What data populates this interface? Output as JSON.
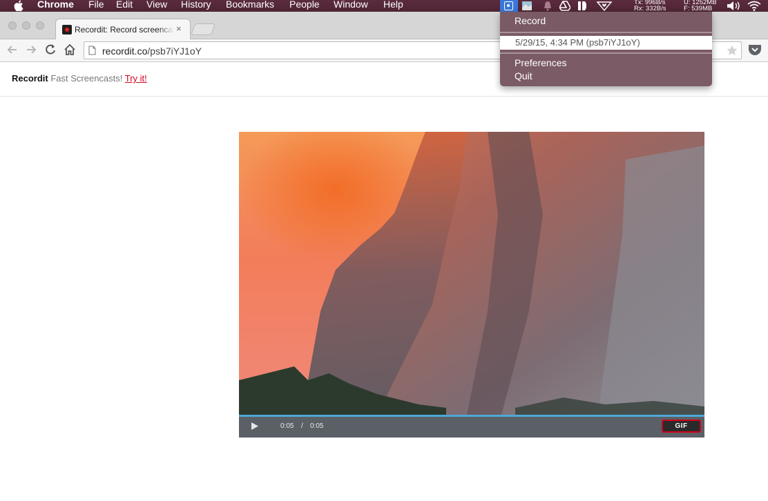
{
  "menubar": {
    "app_name": "Chrome",
    "items": [
      "File",
      "Edit",
      "View",
      "History",
      "Bookmarks",
      "People",
      "Window",
      "Help"
    ],
    "netstat": {
      "tx": "Tx:",
      "tx_rate": "996B/s",
      "rx": "Rx:",
      "rx_rate": "332B/s",
      "u": "U:",
      "u_mem": "1252MB",
      "f": "F:",
      "f_mem": "539MB"
    }
  },
  "browser": {
    "tab_title": "Recordit: Record screencasts",
    "tab_close": "×",
    "url_host": "recordit.co",
    "url_path": "/psb7iYJ1oY"
  },
  "site": {
    "brand": "Recordit",
    "tagline": " Fast Screencasts! ",
    "try_link": "Try it!"
  },
  "player": {
    "current_time": "0:05",
    "separator": "/",
    "duration": "0:05",
    "progress_fraction": 1.0,
    "gif_label": "GIF"
  },
  "recordit_menu": {
    "record": "Record",
    "history_item": "5/29/15, 4:34 PM (psb7iYJ1oY)",
    "preferences": "Preferences",
    "quit": "Quit"
  },
  "colors": {
    "menubar": "#5b2b3e",
    "accent_red": "#d0021b",
    "progress_blue": "#4fa8d8",
    "tray_highlight": "#3a78d8"
  },
  "icons": [
    "apple-icon",
    "recordit-tray-icon",
    "photos-tray-icon",
    "notification-bell-icon",
    "google-drive-icon",
    "bitbar-icon",
    "heart-shield-icon",
    "volume-icon",
    "wifi-icon",
    "back-icon",
    "forward-icon",
    "reload-icon",
    "home-icon",
    "page-icon",
    "bookmark-star-icon",
    "pocket-icon",
    "play-icon"
  ]
}
